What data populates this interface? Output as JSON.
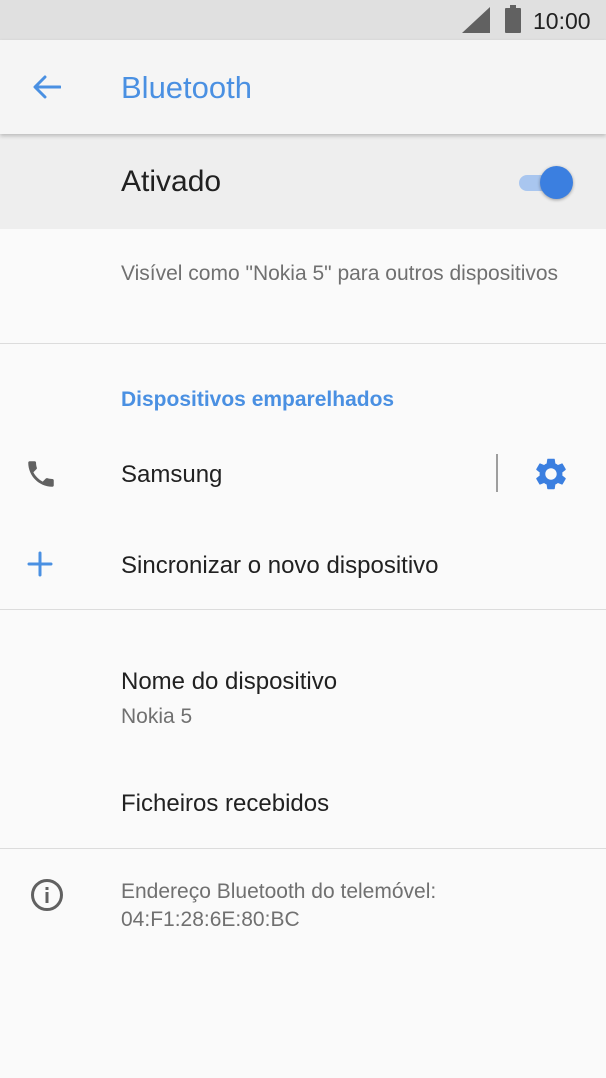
{
  "status_bar": {
    "time": "10:00",
    "icons": [
      "signal-icon",
      "battery-icon"
    ]
  },
  "app_bar": {
    "back_icon": "arrow-back-icon",
    "title": "Bluetooth"
  },
  "master_switch": {
    "label": "Ativado",
    "state": "on",
    "accent_color": "#3b7fe0"
  },
  "visibility_text": "Visível como \"Nokia 5\" para outros dispositivos",
  "paired_devices": {
    "header": "Dispositivos emparelhados",
    "header_color": "#4a90e2",
    "items": [
      {
        "name": "Samsung",
        "icon": "phone-icon",
        "settings_icon": "gear-icon"
      }
    ]
  },
  "pair_new": {
    "icon": "plus-icon",
    "label": "Sincronizar o novo dispositivo"
  },
  "device_name": {
    "label": "Nome do dispositivo",
    "value": "Nokia 5"
  },
  "received_files": {
    "label": "Ficheiros recebidos"
  },
  "bluetooth_address": {
    "icon": "info-icon",
    "text": "Endereço Bluetooth do telemóvel: 04:F1:28:6E:80:BC"
  }
}
